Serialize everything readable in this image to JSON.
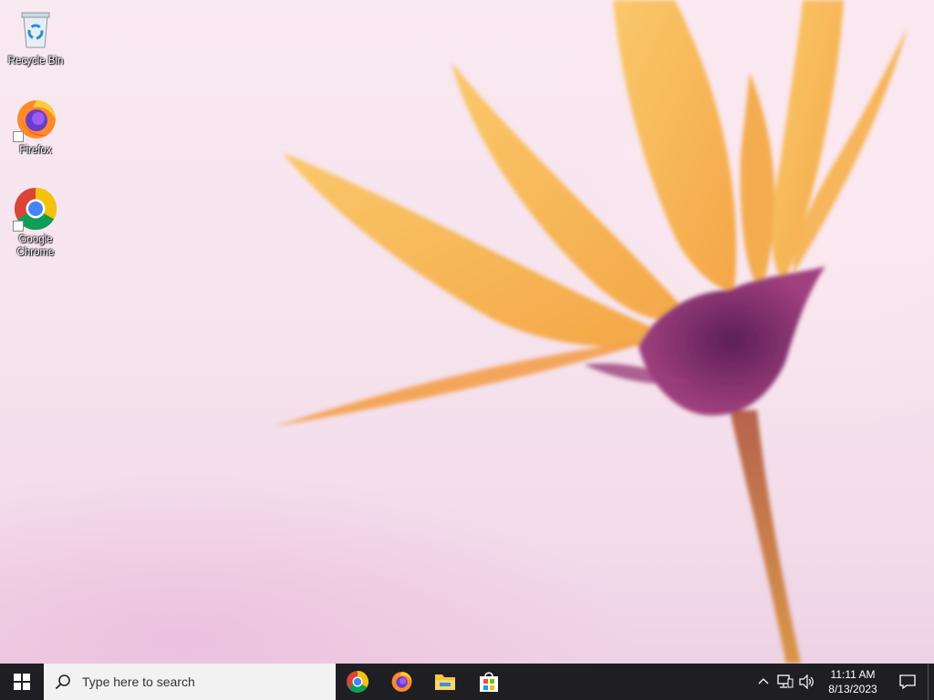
{
  "desktop": {
    "icons": [
      {
        "label": "Recycle Bin",
        "icon": "recycle-bin-icon"
      },
      {
        "label": "Firefox",
        "icon": "firefox-icon"
      },
      {
        "label": "Google Chrome",
        "icon": "chrome-icon"
      }
    ]
  },
  "taskbar": {
    "start_icon": "windows-logo-icon",
    "search": {
      "placeholder": "Type here to search",
      "icon": "search-icon"
    },
    "pinned_apps": [
      {
        "name": "Google Chrome",
        "icon": "chrome-icon"
      },
      {
        "name": "Firefox",
        "icon": "firefox-icon"
      },
      {
        "name": "File Explorer",
        "icon": "folder-icon"
      },
      {
        "name": "Microsoft Store",
        "icon": "store-icon"
      }
    ],
    "tray": {
      "icons": [
        "chevron-up-icon",
        "network-icon",
        "volume-icon"
      ],
      "time": "11:11 AM",
      "date": "8/13/2023",
      "notification_icon": "notification-icon"
    }
  },
  "colors": {
    "taskbar_bg": "#1f1f23",
    "search_bg": "#f2f2f2",
    "petal": "#f7b84a",
    "flower_center": "#7a2a6a",
    "wallpaper_bg": "#f7e6ef"
  }
}
